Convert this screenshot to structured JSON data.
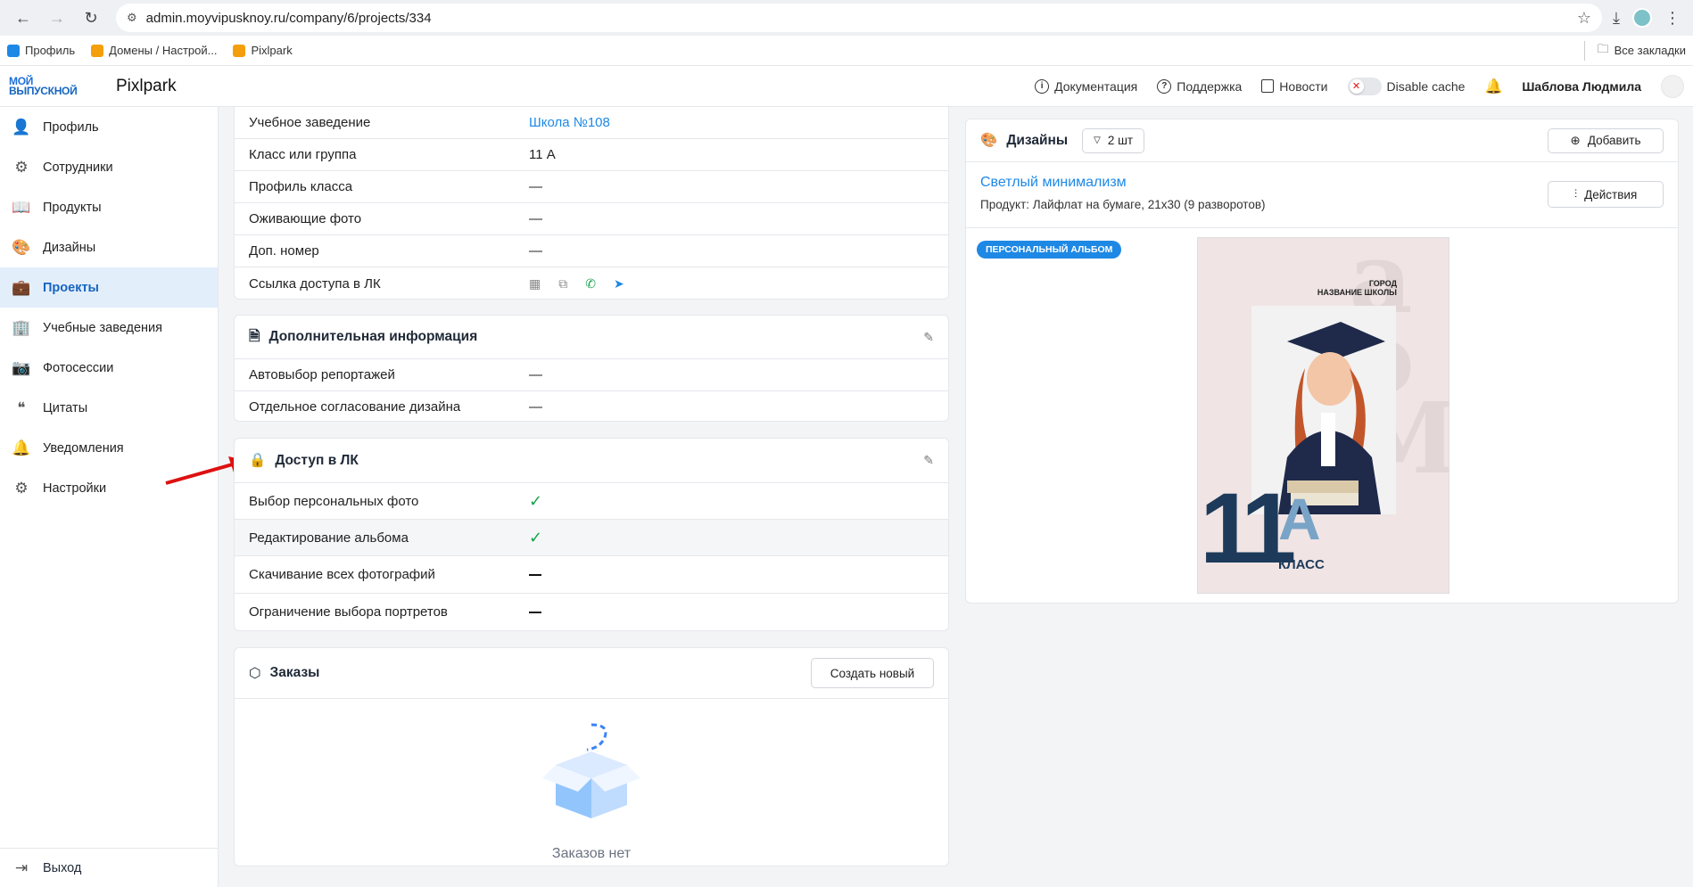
{
  "browser": {
    "url": "admin.moyvipusknoy.ru/company/6/projects/334",
    "bookmarks": [
      {
        "label": "Профиль",
        "color": "#1e88e5"
      },
      {
        "label": "Домены / Настрой...",
        "color": "#f59e0b"
      },
      {
        "label": "Pixlpark",
        "color": "#f59e0b"
      }
    ],
    "all_bookmarks": "Все закладки"
  },
  "header": {
    "logo_line1": "МОЙ",
    "logo_line2": "ВЫПУСКНОЙ",
    "app_title": "Pixlpark",
    "links": [
      "Документация",
      "Поддержка",
      "Новости"
    ],
    "disable_cache": "Disable cache",
    "user": "Шаблова Людмила"
  },
  "sidebar": {
    "items": [
      {
        "label": "Профиль",
        "icon": "user-icon"
      },
      {
        "label": "Сотрудники",
        "icon": "users-gear-icon"
      },
      {
        "label": "Продукты",
        "icon": "book-icon"
      },
      {
        "label": "Дизайны",
        "icon": "palette-icon"
      },
      {
        "label": "Проекты",
        "icon": "briefcase-icon",
        "active": true
      },
      {
        "label": "Учебные заведения",
        "icon": "building-icon"
      },
      {
        "label": "Фотосессии",
        "icon": "camera-icon"
      },
      {
        "label": "Цитаты",
        "icon": "quote-icon"
      },
      {
        "label": "Уведомления",
        "icon": "bell-icon"
      },
      {
        "label": "Настройки",
        "icon": "gear-icon"
      }
    ],
    "logout": "Выход"
  },
  "info": {
    "rows": [
      {
        "label": "Учебное заведение",
        "value": "Школа №108",
        "link": true
      },
      {
        "label": "Класс или группа",
        "value": "11 А"
      },
      {
        "label": "Профиль класса",
        "value": "—"
      },
      {
        "label": "Оживающие фото",
        "value": "—"
      },
      {
        "label": "Доп. номер",
        "value": "—"
      },
      {
        "label": "Ссылка доступа в ЛК",
        "value": ""
      }
    ]
  },
  "additional": {
    "title": "Дополнительная информация",
    "rows": [
      {
        "label": "Автовыбор репортажей",
        "value": "—"
      },
      {
        "label": "Отдельное согласование дизайна",
        "value": "—"
      }
    ]
  },
  "access": {
    "title": "Доступ в ЛК",
    "rows": [
      {
        "label": "Выбор персональных фото",
        "checked": true
      },
      {
        "label": "Редактирование альбома",
        "checked": true
      },
      {
        "label": "Скачивание всех фотографий",
        "checked": false
      },
      {
        "label": "Ограничение выбора портретов",
        "checked": false
      }
    ]
  },
  "orders": {
    "title": "Заказы",
    "create_button": "Создать новый",
    "empty_text": "Заказов нет"
  },
  "designs": {
    "title": "Дизайны",
    "count": "2 шт",
    "add_button": "Добавить",
    "design_name": "Светлый минимализм",
    "product": "Продукт: Лайфлат на бумаге, 21х30 (9 разворотов)",
    "actions_button": "Действия",
    "badge": "ПЕРСОНАЛЬНЫЙ АЛЬБОМ",
    "cover": {
      "city": "ГОРОД",
      "school": "НАЗВАНИЕ ШКОЛЫ",
      "number": "11",
      "letter": "А",
      "class_word": "КЛАСС"
    }
  }
}
